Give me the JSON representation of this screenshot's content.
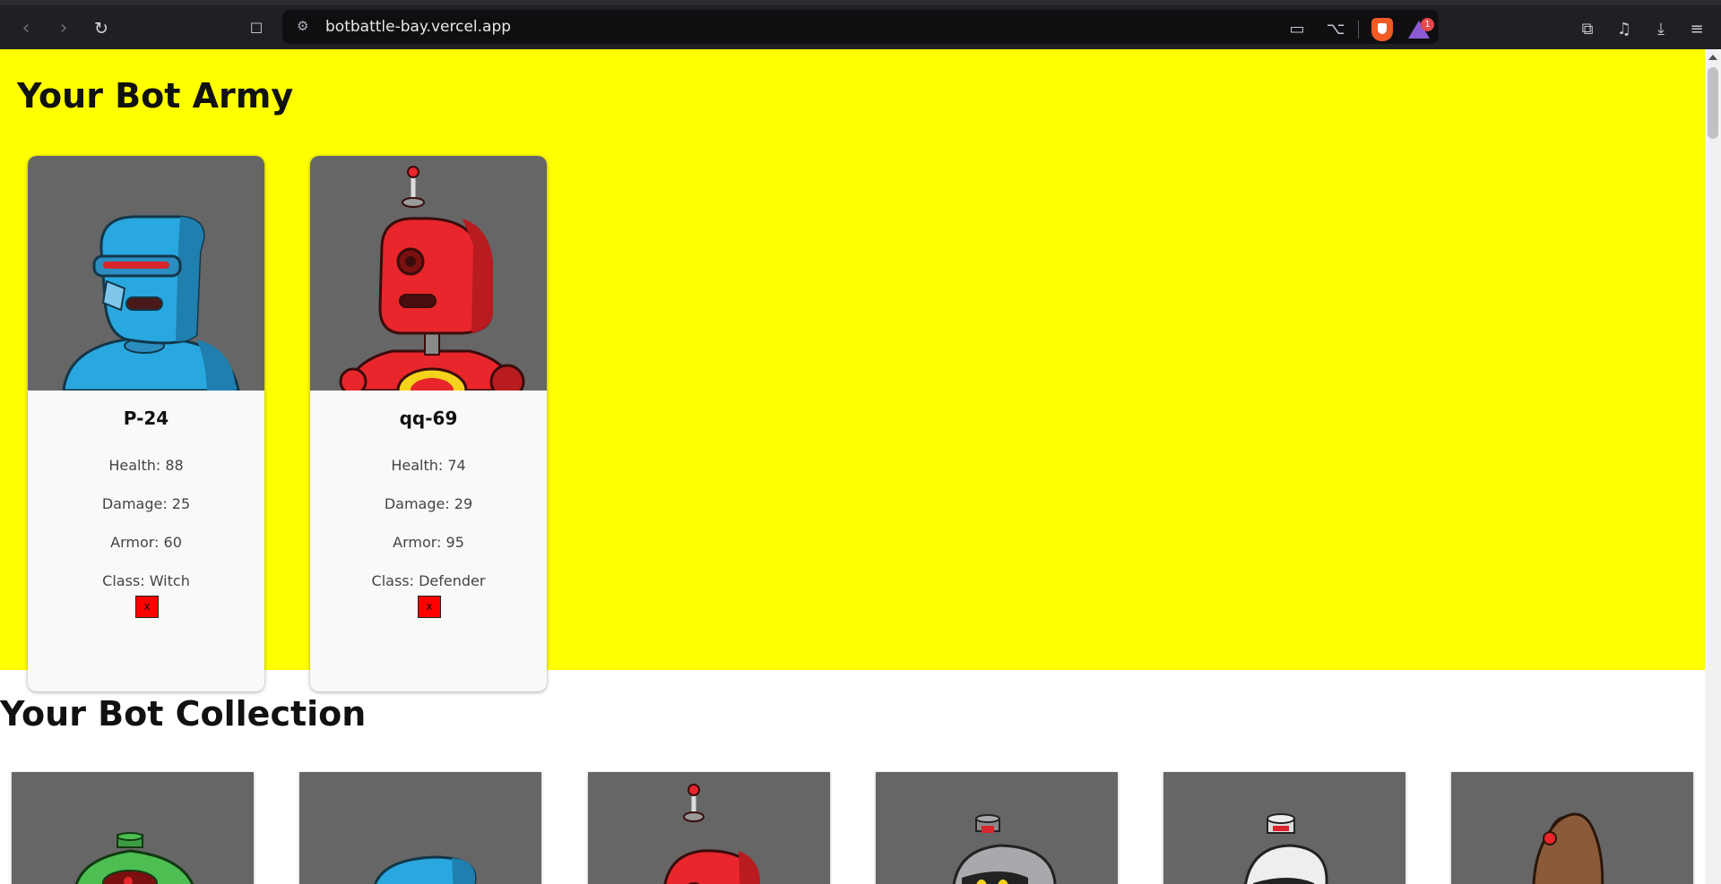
{
  "browser": {
    "url": "botbattle-bay.vercel.app",
    "notification_count": "1"
  },
  "army": {
    "title": "Your Bot Army",
    "bots": [
      {
        "name": "P-24",
        "health": "Health: 88",
        "damage": "Damage: 25",
        "armor": "Armor: 60",
        "class": "Class: Witch",
        "delete_label": "x",
        "color": "#29a8e0"
      },
      {
        "name": "qq-69",
        "health": "Health: 74",
        "damage": "Damage: 29",
        "armor": "Armor: 95",
        "class": "Class: Defender",
        "delete_label": "x",
        "color": "#e8262b"
      }
    ]
  },
  "collection": {
    "title": "Your Bot Collection",
    "bot_colors": [
      "#4cbe52",
      "#29a8e0",
      "#e8262b",
      "#a7a9ac",
      "#eeeeee",
      "#8a5a3a"
    ]
  }
}
